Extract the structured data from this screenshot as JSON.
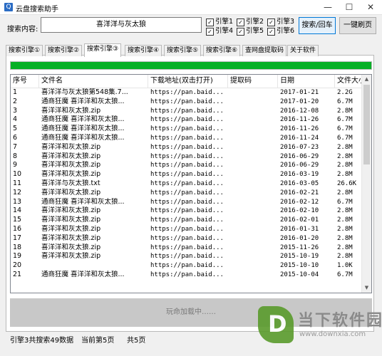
{
  "window": {
    "title": "云盘搜索助手",
    "app_icon": "Q",
    "minimize": "—",
    "maximize": "☐",
    "close": "✕"
  },
  "search": {
    "label": "搜索内容:",
    "value": "喜洋洋与灰太狼",
    "engines": [
      {
        "label": "引擎1",
        "checked": true
      },
      {
        "label": "引擎2",
        "checked": true
      },
      {
        "label": "引擎3",
        "checked": true
      },
      {
        "label": "引擎4",
        "checked": true
      },
      {
        "label": "引擎5",
        "checked": true
      },
      {
        "label": "引擎6",
        "checked": true
      }
    ],
    "search_button": "搜索/回车",
    "refresh_button": "一键刷页"
  },
  "tabs": [
    {
      "label": "搜索引擎①",
      "active": false
    },
    {
      "label": "搜索引擎②",
      "active": false
    },
    {
      "label": "搜索引擎③",
      "active": true
    },
    {
      "label": "搜索引擎④",
      "active": false
    },
    {
      "label": "搜索引擎⑤",
      "active": false
    },
    {
      "label": "搜索引擎⑥",
      "active": false
    },
    {
      "label": "查网盘提取码",
      "active": false
    },
    {
      "label": "关于软件",
      "active": false
    }
  ],
  "progress": {
    "value": 1.0,
    "color": "#06b025"
  },
  "table": {
    "columns": [
      "序号",
      "文件名",
      "下载地址(双击打开)",
      "提取码",
      "日期",
      "文件大小"
    ],
    "rows": [
      [
        "1",
        "喜洋洋与灰太狼第548集.7...",
        "https://pan.baid...",
        "",
        "2017-01-21",
        "2.2G"
      ],
      [
        "2",
        "通商狂魔 喜洋洋和灰太狼...",
        "https://pan.baid...",
        "",
        "2017-01-20",
        "6.7M"
      ],
      [
        "3",
        "喜洋洋和灰太狼.zip",
        "https://pan.baid...",
        "",
        "2016-12-08",
        "2.8M"
      ],
      [
        "4",
        "通商狂魔 喜洋洋和灰太狼...",
        "https://pan.baid...",
        "",
        "2016-11-26",
        "6.7M"
      ],
      [
        "5",
        "通商狂魔 喜洋洋和灰太狼...",
        "https://pan.baid...",
        "",
        "2016-11-26",
        "6.7M"
      ],
      [
        "6",
        "通商狂魔 喜洋洋和灰太狼...",
        "https://pan.baid...",
        "",
        "2016-11-24",
        "6.7M"
      ],
      [
        "7",
        "喜洋洋和灰太狼.zip",
        "https://pan.baid...",
        "",
        "2016-07-23",
        "2.8M"
      ],
      [
        "8",
        "喜洋洋和灰太狼.zip",
        "https://pan.baid...",
        "",
        "2016-06-29",
        "2.8M"
      ],
      [
        "9",
        "喜洋洋和灰太狼.zip",
        "https://pan.baid...",
        "",
        "2016-06-29",
        "2.8M"
      ],
      [
        "10",
        "喜洋洋和灰太狼.zip",
        "https://pan.baid...",
        "",
        "2016-03-19",
        "2.8M"
      ],
      [
        "11",
        "喜洋洋与灰太狼.txt",
        "https://pan.baid...",
        "",
        "2016-03-05",
        "26.6K"
      ],
      [
        "12",
        "喜洋洋和灰太狼.zip",
        "https://pan.baid...",
        "",
        "2016-02-21",
        "2.8M"
      ],
      [
        "13",
        "通商狂魔 喜洋洋和灰太狼...",
        "https://pan.baid...",
        "",
        "2016-02-12",
        "6.7M"
      ],
      [
        "14",
        "喜洋洋和灰太狼.zip",
        "https://pan.baid...",
        "",
        "2016-02-10",
        "2.8M"
      ],
      [
        "15",
        "喜洋洋和灰太狼.zip",
        "https://pan.baid...",
        "",
        "2016-02-01",
        "2.8M"
      ],
      [
        "16",
        "喜洋洋和灰太狼.zip",
        "https://pan.baid...",
        "",
        "2016-01-31",
        "2.8M"
      ],
      [
        "17",
        "喜洋洋和灰太狼.zip",
        "https://pan.baid...",
        "",
        "2016-01-20",
        "2.8M"
      ],
      [
        "18",
        "喜洋洋和灰太狼.zip",
        "https://pan.baid...",
        "",
        "2015-11-26",
        "2.8M"
      ],
      [
        "19",
        "喜洋洋和灰太狼.zip",
        "https://pan.baid...",
        "",
        "2015-10-19",
        "2.8M"
      ],
      [
        "20",
        "",
        "https://pan.baid...",
        "",
        "2015-10-10",
        "1.0K"
      ],
      [
        "21",
        "通商狂魔 喜洋洋和灰太狼...",
        "https://pan.baid...",
        "",
        "2015-10-04",
        "6.7M"
      ]
    ]
  },
  "loading_text": "玩命加载中……",
  "status": {
    "engine_summary": "引擎3共搜索49数据",
    "current_page": "当前第5页",
    "total_pages": "共5页"
  },
  "watermark": {
    "logo_glyph": "D",
    "name": "当下软件园",
    "url": "www.downxia.com",
    "color": "#5a9b2c"
  }
}
